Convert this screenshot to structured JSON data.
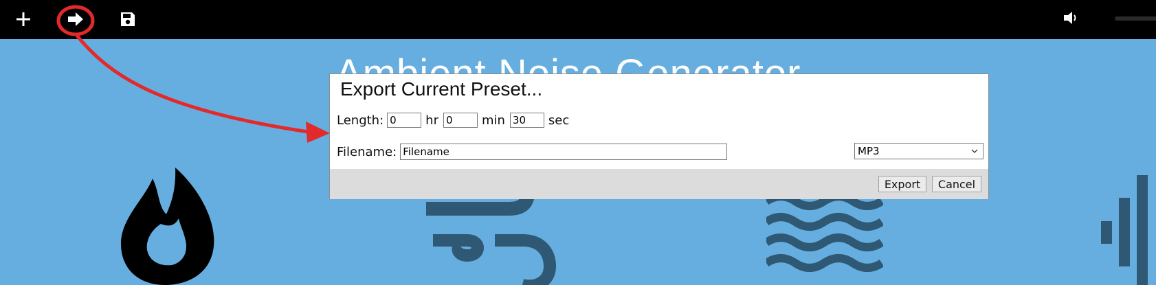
{
  "app": {
    "title": "Ambient Noise Generator"
  },
  "toolbar": {
    "add_icon": "plus-icon",
    "export_icon": "arrow-right-icon",
    "save_icon": "floppy-disk-icon",
    "volume_icon": "speaker-icon",
    "volume_level": 0.0
  },
  "dialog": {
    "title": "Export Current Preset...",
    "length_label": "Length:",
    "hours_value": "0",
    "hours_unit": "hr",
    "minutes_value": "0",
    "minutes_unit": "min",
    "seconds_value": "30",
    "seconds_unit": "sec",
    "filename_label": "Filename:",
    "filename_value": "Filename",
    "format_selected": "MP3",
    "export_label": "Export",
    "cancel_label": "Cancel"
  },
  "sounds": [
    {
      "icon": "fire-icon"
    },
    {
      "icon": "wind-icon"
    },
    {
      "icon": "water-waves-icon"
    },
    {
      "icon": "equalizer-icon"
    }
  ],
  "colors": {
    "background": "#66aedf",
    "toolbar": "#000000",
    "icon_dark": "#2f5874",
    "annotation": "#e32a2a"
  }
}
